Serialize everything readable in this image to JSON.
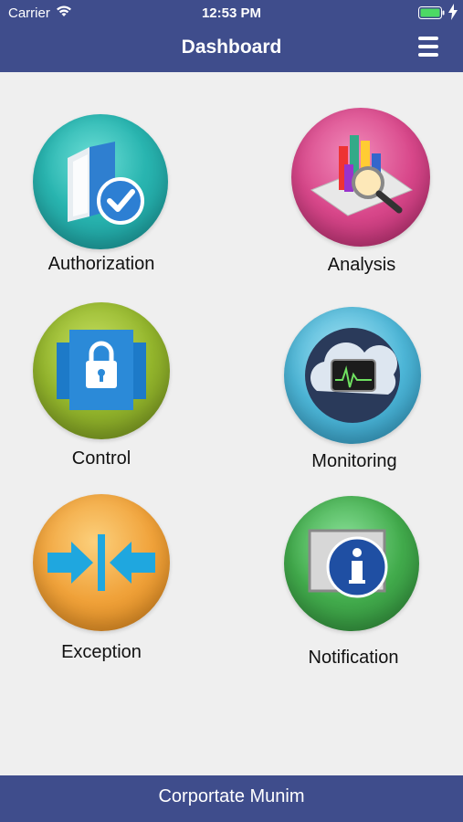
{
  "status_bar": {
    "carrier": "Carrier",
    "time": "12:53 PM"
  },
  "header": {
    "title": "Dashboard",
    "menu_icon": "hamburger-menu-icon"
  },
  "tiles": [
    {
      "label": "Authorization",
      "icon": "folder-check-icon",
      "color": "#2bbcb8"
    },
    {
      "label": "Analysis",
      "icon": "chart-magnifier-icon",
      "color": "#d44c8a"
    },
    {
      "label": "Control",
      "icon": "lock-icon",
      "color": "#8fb22e"
    },
    {
      "label": "Monitoring",
      "icon": "cloud-monitor-icon",
      "color": "#4fb8d8"
    },
    {
      "label": "Exception",
      "icon": "arrows-converge-icon",
      "color": "#f0a23a"
    },
    {
      "label": "Notification",
      "icon": "info-icon",
      "color": "#3fa84a"
    }
  ],
  "footer": {
    "text": "Corportate Munim"
  }
}
